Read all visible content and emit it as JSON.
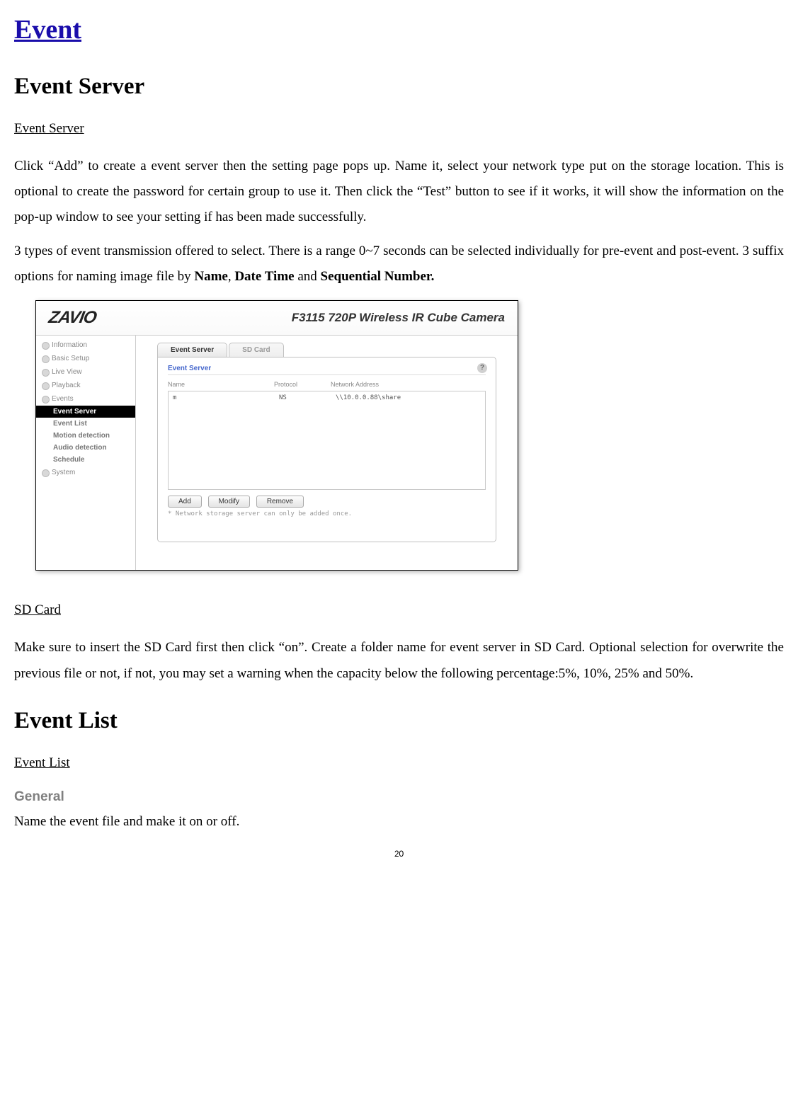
{
  "titles": {
    "main": "Event",
    "eventServer": "Event Server",
    "eventServerUnderline": "Event Server",
    "sdCardUnderline": "SD Card",
    "eventList": "Event List",
    "eventListUnderline": "Event List",
    "general": "General"
  },
  "paragraphs": {
    "p1": "Click “Add” to create a event server then the setting page pops up. Name it, select your network type put on the storage location. This is optional to create the password for certain group to use it. Then click the “Test” button to see if it works, it will show the information on the pop-up window to see your setting if has been made successfully.",
    "p2a": "3 types of event transmission offered to select. There is a range 0~7 seconds can be selected individually for pre-event and post-event. 3 suffix options for naming image file by ",
    "p2b": "Name",
    "p2c": ", ",
    "p2d": "Date Time",
    "p2e": " and ",
    "p2f": "Sequential Number.",
    "sdcard": "Make sure to insert the SD Card first then click “on”. Create a folder name for event server in SD Card. Optional selection for overwrite the previous file or not, if not, you may set a warning when the capacity below the following percentage:5%, 10%, 25% and 50%.",
    "generalDesc": "Name the event file and make it on or off."
  },
  "screenshot": {
    "logo": "ZAVIO",
    "product": "F3115 720P Wireless IR Cube Camera",
    "sidebar": {
      "information": "Information",
      "basicSetup": "Basic Setup",
      "liveView": "Live View",
      "playback": "Playback",
      "events": "Events",
      "system": "System"
    },
    "subitems": {
      "eventServer": "Event Server",
      "eventList": "Event List",
      "motion": "Motion detection",
      "audio": "Audio detection",
      "schedule": "Schedule"
    },
    "tabs": {
      "eventServer": "Event Server",
      "sdCard": "SD Card"
    },
    "panel": {
      "title": "Event Server",
      "help": "?",
      "colName": "Name",
      "colProtocol": "Protocol",
      "colAddress": "Network Address",
      "rowName": "m",
      "rowProtocol": "NS",
      "rowAddress": "\\\\10.0.0.88\\share",
      "btnAdd": "Add",
      "btnModify": "Modify",
      "btnRemove": "Remove",
      "footnote": "* Network storage server can only be added once."
    }
  },
  "pageNumber": "20"
}
